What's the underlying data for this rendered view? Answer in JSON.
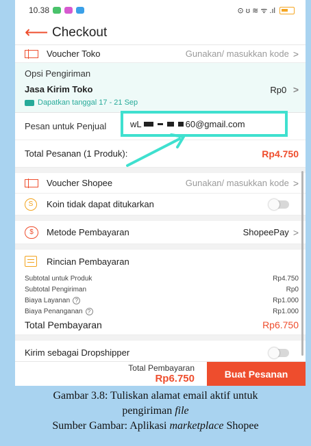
{
  "status_bar": {
    "time": "10.38",
    "right_text": "⊙ ʊ ≋ ᯤ .ıl"
  },
  "header": {
    "title": "Checkout"
  },
  "voucher_toko": {
    "label": "Voucher Toko",
    "value": "Gunakan/ masukkan kode"
  },
  "shipping": {
    "section_title": "Opsi Pengiriman",
    "courier": "Jasa Kirim Toko",
    "price": "Rp0",
    "date_text": "Dapatkan tanggal 17 - 21 Sep"
  },
  "message": {
    "label": "Pesan untuk Penjual",
    "prefix": "wL",
    "suffix": "60@gmail.com"
  },
  "order_total": {
    "label": "Total Pesanan (1 Produk):",
    "value": "Rp4.750"
  },
  "voucher_shopee": {
    "label": "Voucher Shopee",
    "value": "Gunakan/ masukkan kode"
  },
  "coins": {
    "icon_text": "S",
    "label": "Koin tidak dapat ditukarkan"
  },
  "payment": {
    "icon_text": "$",
    "label": "Metode Pembayaran",
    "value": "ShopeePay"
  },
  "details": {
    "title": "Rincian Pembayaran",
    "lines": [
      {
        "label": "Subtotal untuk Produk",
        "value": "Rp4.750"
      },
      {
        "label": "Subtotal Pengiriman",
        "value": "Rp0"
      },
      {
        "label": "Biaya Layanan",
        "value": "Rp1.000"
      },
      {
        "label": "Biaya Penanganan",
        "value": "Rp1.000"
      }
    ],
    "grand_label": "Total Pembayaran",
    "grand_value": "Rp6.750"
  },
  "dropship": {
    "label": "Kirim sebagai Dropshipper"
  },
  "bottom": {
    "total_label": "Total Pembayaran",
    "total_value": "Rp6.750",
    "button": "Buat Pesanan"
  },
  "caption": {
    "line1": "Gambar 3.8: Tuliskan alamat email aktif untuk",
    "line2_text": "pengiriman ",
    "line2_italic": "file",
    "line3_text": "Sumber Gambar: Aplikasi ",
    "line3_italic": "marketplace",
    "line3_end": " Shopee"
  },
  "colors": {
    "accent": "#ee4d2d",
    "highlight": "#3fe0cf",
    "ship_green": "#26aa99",
    "background": "#a9d3f0"
  },
  "icons": {
    "back": "arrow-left-icon",
    "chevron": "chevron-right-icon",
    "truck": "truck-icon",
    "help": "help-circle-icon"
  }
}
